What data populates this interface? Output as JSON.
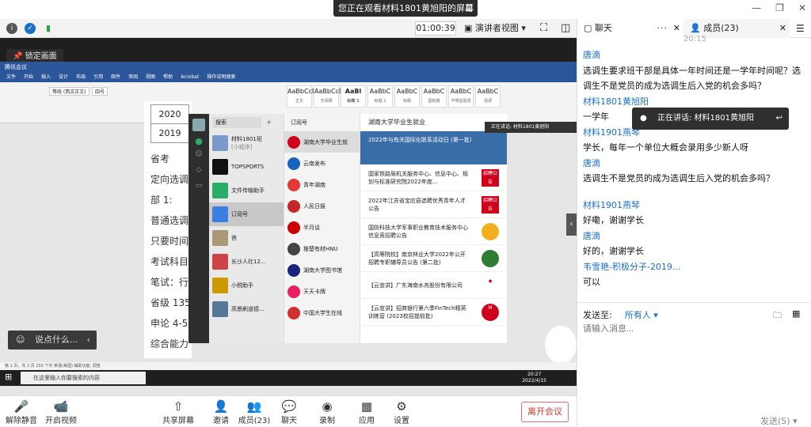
{
  "topbar": {
    "notice": "您正在观看材料1801黄旭阳的屏幕",
    "menu_icon": "hamburger-icon"
  },
  "toolbar": {
    "timer": "01:00:39",
    "presenter_view": "演讲者视图"
  },
  "share": {
    "lock_label": "锁定画面",
    "word": {
      "title": "腾讯会议",
      "menus": [
        "文件",
        "开始",
        "插入",
        "设计",
        "布局",
        "引用",
        "邮件",
        "审阅",
        "视图",
        "帮助",
        "Acrobat",
        "操作说明搜索"
      ],
      "font_name": "等线 (西文正文)",
      "font_size": "四号",
      "styles": [
        {
          "preview": "AaBbCcDc",
          "name": "正文"
        },
        {
          "preview": "AaBbCcDc",
          "name": "无间隔"
        },
        {
          "preview": "AaBl",
          "name": "标题 1"
        },
        {
          "preview": "AaBbC",
          "name": "标题 2"
        },
        {
          "preview": "AaBbC",
          "name": "标题"
        },
        {
          "preview": "AaBbC",
          "name": "副标题"
        },
        {
          "preview": "AaBbC",
          "name": "不明显强调"
        },
        {
          "preview": "AaBbC",
          "name": "强调"
        }
      ],
      "doc_table": [
        "2020",
        "2019"
      ],
      "doc_lines": [
        "省考",
        "定向选调",
        "部  1:",
        "普通选调",
        "只要时间",
        "考试科目",
        "笔试：行",
        "省级 135",
        "申论 4-5",
        "综合能力"
      ],
      "status": "第 1 页，共 2 页   250 个字   英语(美国)   辅助功能: 调查"
    },
    "wechat": {
      "search": "搜索",
      "chats": [
        {
          "name": "材料1801班",
          "preview": "[小程序]"
        },
        {
          "name": "TOPSPORTS",
          "preview": ""
        },
        {
          "name": "文件传输助手",
          "preview": ""
        },
        {
          "name": "订阅号",
          "preview": ""
        },
        {
          "name": "爸",
          "preview": ""
        },
        {
          "name": "长沙人社12...",
          "preview": ""
        },
        {
          "name": "小税助手",
          "preview": ""
        },
        {
          "name": "高景刷道德...",
          "preview": ""
        }
      ],
      "subs_title": "订阅号",
      "subs": [
        "湖南大学毕业生就",
        "云南发布",
        "青年湖南",
        "人民日报",
        "半月谈",
        "推楚有材HNU",
        "湖南大学图书馆",
        "天天卡牌",
        "中国大学生在线"
      ],
      "feed_title": "湖南大学毕业生就业",
      "banner": "2022年与有关国际化联系活动日 (第一批)",
      "feed": [
        "国家铁路局机关服务中心、信息中心、规划与标准研究院2022年度...",
        "2022年江苏省宝应县选聘优秀青年人才公告",
        "国防科技大学军事职业教育技术服务中心信息竞招聘公告",
        "【高等院校】南京林业大学2022年公开招聘专职辅导员公告 (第二批)",
        "【云宣讲】广东海南水务股份有限公司",
        "【云宣讲】招商银行第六季FinTech精英训练营 (2023校招提前批)"
      ],
      "feed_badge": "招聘公告"
    },
    "speaking": "正在讲话: 材料1801黄旭阳",
    "say_placeholder": "说点什么...",
    "taskbar_search": "在这里输入你要搜索的内容",
    "clock_time": "20:27",
    "clock_date": "2022/4/15"
  },
  "bottombar": {
    "mute": "解除静音",
    "video": "开启视频",
    "share": "共享屏幕",
    "invite": "邀请",
    "members": "成员(23)",
    "chat": "聊天",
    "record": "录制",
    "apps": "应用",
    "settings": "设置",
    "leave": "离开会议"
  },
  "panel": {
    "tab_chat": "聊天",
    "tab_members": "成员(23)",
    "time_partial": "20:15",
    "messages": [
      {
        "sender": "唐滴",
        "text": "选调生要求班干部是具体一年时间还是一学年时间呢？选调生不是党员的成为选调生后入党的机会多吗？"
      },
      {
        "sender": "材料1801黄旭阳",
        "text": "一学年"
      },
      {
        "sender": "材料1901燕琴",
        "text": "学长，每年一个单位大概会录用多少新人呀"
      },
      {
        "sender": "唐滴",
        "text": "选调生不是党员的成为选调生后入党的机会多吗？"
      },
      {
        "sender": "材料1901燕琴",
        "text": "好嘞，谢谢学长"
      },
      {
        "sender": "唐滴",
        "text": "好的，谢谢学长"
      },
      {
        "sender": "韦雪艳-积极分子-2019...",
        "text": "可以"
      }
    ],
    "speaking": "正在讲话: 材料1801黄旭阳",
    "send_to_label": "发送至:",
    "send_to_value": "所有人",
    "input_placeholder": "请输入消息...",
    "send_button": "发送(S)"
  }
}
